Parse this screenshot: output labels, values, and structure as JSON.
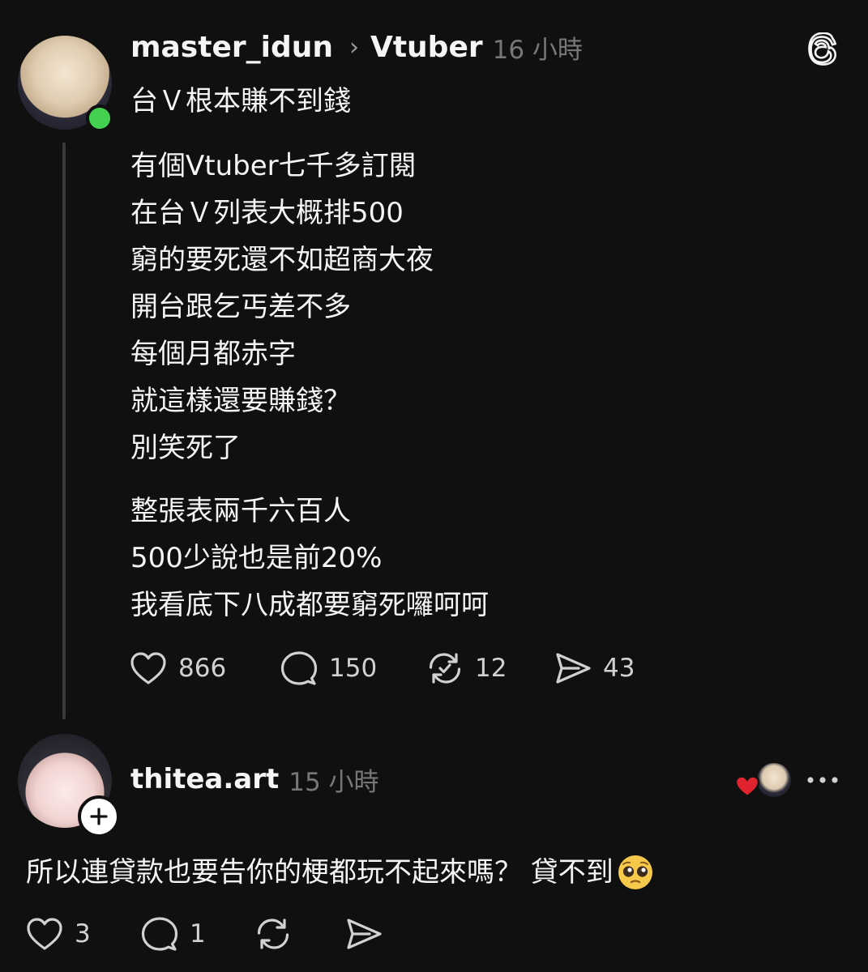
{
  "post": {
    "username": "master_idun",
    "topic": "Vtuber",
    "timestamp": "16 小時",
    "title": "台Ｖ根本賺不到錢",
    "paragraphs": [
      [
        "有個Vtuber七千多訂閱",
        "在台Ｖ列表大概排500",
        "窮的要死還不如超商大夜",
        "開台跟乞丐差不多",
        "每個月都赤字",
        "就這樣還要賺錢？",
        "別笑死了"
      ],
      [
        "整張表兩千六百人",
        "500少說也是前20%",
        "我看底下八成都要窮死囉呵呵"
      ]
    ],
    "likes": "866",
    "comments": "150",
    "reposts": "12",
    "shares": "43",
    "online_color": "#44d150"
  },
  "reply": {
    "username": "thitea.art",
    "timestamp": "15 小時",
    "text": "所以連貸款也要告你的梗都玩不起來嗎？ 貸不到",
    "emoji": "pleading-face-emoji",
    "likes": "3",
    "comments": "1",
    "liked_by_author_color": "#e0242f"
  },
  "icons": {
    "app_logo": "threads-logo-icon",
    "like": "heart-icon",
    "comment": "comment-bubble-icon",
    "repost": "repost-icon",
    "share": "send-icon",
    "more": "more-dots-icon",
    "follow": "plus-icon"
  }
}
